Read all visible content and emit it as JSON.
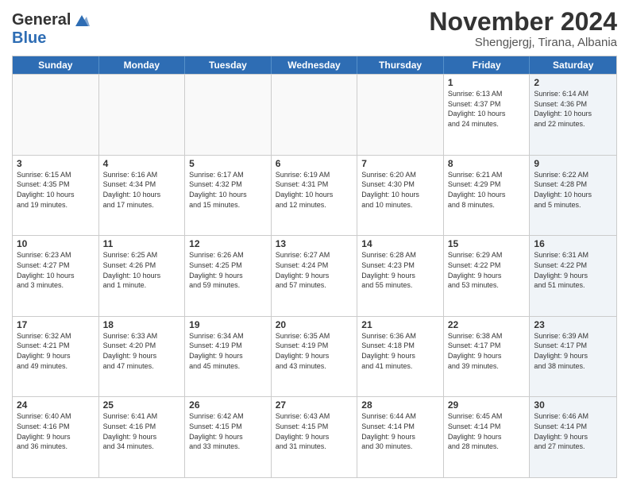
{
  "logo": {
    "line1": "General",
    "line2": "Blue"
  },
  "header": {
    "month": "November 2024",
    "location": "Shengjergj, Tirana, Albania"
  },
  "weekdays": [
    "Sunday",
    "Monday",
    "Tuesday",
    "Wednesday",
    "Thursday",
    "Friday",
    "Saturday"
  ],
  "rows": [
    [
      {
        "day": "",
        "info": "",
        "shaded": false,
        "empty": true
      },
      {
        "day": "",
        "info": "",
        "shaded": false,
        "empty": true
      },
      {
        "day": "",
        "info": "",
        "shaded": false,
        "empty": true
      },
      {
        "day": "",
        "info": "",
        "shaded": false,
        "empty": true
      },
      {
        "day": "",
        "info": "",
        "shaded": false,
        "empty": true
      },
      {
        "day": "1",
        "info": "Sunrise: 6:13 AM\nSunset: 4:37 PM\nDaylight: 10 hours\nand 24 minutes.",
        "shaded": false,
        "empty": false
      },
      {
        "day": "2",
        "info": "Sunrise: 6:14 AM\nSunset: 4:36 PM\nDaylight: 10 hours\nand 22 minutes.",
        "shaded": true,
        "empty": false
      }
    ],
    [
      {
        "day": "3",
        "info": "Sunrise: 6:15 AM\nSunset: 4:35 PM\nDaylight: 10 hours\nand 19 minutes.",
        "shaded": false,
        "empty": false
      },
      {
        "day": "4",
        "info": "Sunrise: 6:16 AM\nSunset: 4:34 PM\nDaylight: 10 hours\nand 17 minutes.",
        "shaded": false,
        "empty": false
      },
      {
        "day": "5",
        "info": "Sunrise: 6:17 AM\nSunset: 4:32 PM\nDaylight: 10 hours\nand 15 minutes.",
        "shaded": false,
        "empty": false
      },
      {
        "day": "6",
        "info": "Sunrise: 6:19 AM\nSunset: 4:31 PM\nDaylight: 10 hours\nand 12 minutes.",
        "shaded": false,
        "empty": false
      },
      {
        "day": "7",
        "info": "Sunrise: 6:20 AM\nSunset: 4:30 PM\nDaylight: 10 hours\nand 10 minutes.",
        "shaded": false,
        "empty": false
      },
      {
        "day": "8",
        "info": "Sunrise: 6:21 AM\nSunset: 4:29 PM\nDaylight: 10 hours\nand 8 minutes.",
        "shaded": false,
        "empty": false
      },
      {
        "day": "9",
        "info": "Sunrise: 6:22 AM\nSunset: 4:28 PM\nDaylight: 10 hours\nand 5 minutes.",
        "shaded": true,
        "empty": false
      }
    ],
    [
      {
        "day": "10",
        "info": "Sunrise: 6:23 AM\nSunset: 4:27 PM\nDaylight: 10 hours\nand 3 minutes.",
        "shaded": false,
        "empty": false
      },
      {
        "day": "11",
        "info": "Sunrise: 6:25 AM\nSunset: 4:26 PM\nDaylight: 10 hours\nand 1 minute.",
        "shaded": false,
        "empty": false
      },
      {
        "day": "12",
        "info": "Sunrise: 6:26 AM\nSunset: 4:25 PM\nDaylight: 9 hours\nand 59 minutes.",
        "shaded": false,
        "empty": false
      },
      {
        "day": "13",
        "info": "Sunrise: 6:27 AM\nSunset: 4:24 PM\nDaylight: 9 hours\nand 57 minutes.",
        "shaded": false,
        "empty": false
      },
      {
        "day": "14",
        "info": "Sunrise: 6:28 AM\nSunset: 4:23 PM\nDaylight: 9 hours\nand 55 minutes.",
        "shaded": false,
        "empty": false
      },
      {
        "day": "15",
        "info": "Sunrise: 6:29 AM\nSunset: 4:22 PM\nDaylight: 9 hours\nand 53 minutes.",
        "shaded": false,
        "empty": false
      },
      {
        "day": "16",
        "info": "Sunrise: 6:31 AM\nSunset: 4:22 PM\nDaylight: 9 hours\nand 51 minutes.",
        "shaded": true,
        "empty": false
      }
    ],
    [
      {
        "day": "17",
        "info": "Sunrise: 6:32 AM\nSunset: 4:21 PM\nDaylight: 9 hours\nand 49 minutes.",
        "shaded": false,
        "empty": false
      },
      {
        "day": "18",
        "info": "Sunrise: 6:33 AM\nSunset: 4:20 PM\nDaylight: 9 hours\nand 47 minutes.",
        "shaded": false,
        "empty": false
      },
      {
        "day": "19",
        "info": "Sunrise: 6:34 AM\nSunset: 4:19 PM\nDaylight: 9 hours\nand 45 minutes.",
        "shaded": false,
        "empty": false
      },
      {
        "day": "20",
        "info": "Sunrise: 6:35 AM\nSunset: 4:19 PM\nDaylight: 9 hours\nand 43 minutes.",
        "shaded": false,
        "empty": false
      },
      {
        "day": "21",
        "info": "Sunrise: 6:36 AM\nSunset: 4:18 PM\nDaylight: 9 hours\nand 41 minutes.",
        "shaded": false,
        "empty": false
      },
      {
        "day": "22",
        "info": "Sunrise: 6:38 AM\nSunset: 4:17 PM\nDaylight: 9 hours\nand 39 minutes.",
        "shaded": false,
        "empty": false
      },
      {
        "day": "23",
        "info": "Sunrise: 6:39 AM\nSunset: 4:17 PM\nDaylight: 9 hours\nand 38 minutes.",
        "shaded": true,
        "empty": false
      }
    ],
    [
      {
        "day": "24",
        "info": "Sunrise: 6:40 AM\nSunset: 4:16 PM\nDaylight: 9 hours\nand 36 minutes.",
        "shaded": false,
        "empty": false
      },
      {
        "day": "25",
        "info": "Sunrise: 6:41 AM\nSunset: 4:16 PM\nDaylight: 9 hours\nand 34 minutes.",
        "shaded": false,
        "empty": false
      },
      {
        "day": "26",
        "info": "Sunrise: 6:42 AM\nSunset: 4:15 PM\nDaylight: 9 hours\nand 33 minutes.",
        "shaded": false,
        "empty": false
      },
      {
        "day": "27",
        "info": "Sunrise: 6:43 AM\nSunset: 4:15 PM\nDaylight: 9 hours\nand 31 minutes.",
        "shaded": false,
        "empty": false
      },
      {
        "day": "28",
        "info": "Sunrise: 6:44 AM\nSunset: 4:14 PM\nDaylight: 9 hours\nand 30 minutes.",
        "shaded": false,
        "empty": false
      },
      {
        "day": "29",
        "info": "Sunrise: 6:45 AM\nSunset: 4:14 PM\nDaylight: 9 hours\nand 28 minutes.",
        "shaded": false,
        "empty": false
      },
      {
        "day": "30",
        "info": "Sunrise: 6:46 AM\nSunset: 4:14 PM\nDaylight: 9 hours\nand 27 minutes.",
        "shaded": true,
        "empty": false
      }
    ]
  ]
}
